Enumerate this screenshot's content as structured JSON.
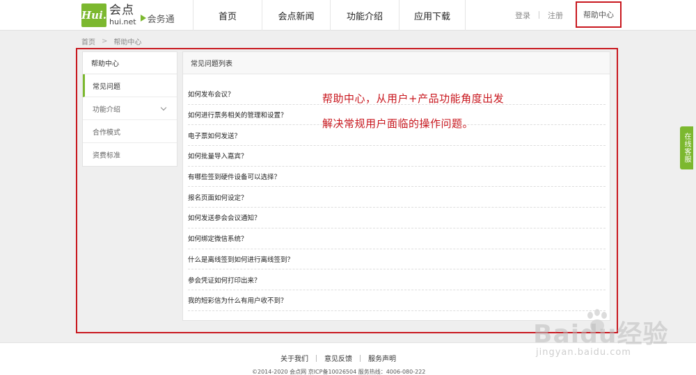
{
  "header": {
    "logo_badge": "Hui.",
    "logo_cn": "会点",
    "logo_net": "hui.net",
    "logo_sub": "会务通",
    "nav": [
      {
        "label": "首页"
      },
      {
        "label": "会点新闻"
      },
      {
        "label": "功能介绍"
      },
      {
        "label": "应用下载"
      }
    ],
    "login_label": "登录",
    "register_label": "注册",
    "help_label": "帮助中心"
  },
  "breadcrumb": {
    "home": "首页",
    "separator": ">",
    "current": "帮助中心"
  },
  "sidebar": {
    "title": "帮助中心",
    "items": [
      {
        "label": "常见问题",
        "active": true
      },
      {
        "label": "功能介绍",
        "has_chevron": true
      },
      {
        "label": "合作模式"
      },
      {
        "label": "资费标准"
      }
    ]
  },
  "main": {
    "title": "常见问题列表",
    "questions": [
      "如何发布会议？",
      "如何进行票务相关的管理和设置？",
      "电子票如何发送？",
      "如何批量导入嘉宾？",
      "有哪些签到硬件设备可以选择？",
      "报名页面如何设定？",
      "如何发送参会会议通知？",
      "如何绑定微信系统？",
      "什么是离线签到如何进行离线签到？",
      "参会凭证如何打印出来？",
      "我的短彩信为什么有用户收不到？"
    ]
  },
  "annotation": {
    "line1": "帮助中心，从用户+产品功能角度出发",
    "line2": "解决常规用户面临的操作问题。"
  },
  "float_tab": {
    "label": "在线客服"
  },
  "footer": {
    "links": [
      "关于我们",
      "意见反馈",
      "服务声明"
    ],
    "copyright": "©2014-2020 会点网 京ICP备10026504 服务热线：4006-080-222"
  },
  "watermark": {
    "text": "Baidu经验",
    "url": "jingyan.baidu.com"
  },
  "colors": {
    "brand_green": "#7cb82f",
    "highlight_red": "#c8161d"
  }
}
